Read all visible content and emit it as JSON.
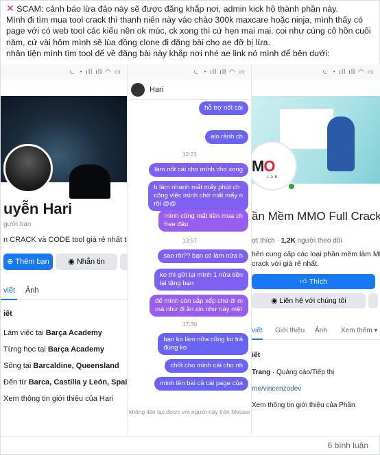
{
  "post": {
    "lines": [
      "SCAM: cảnh báo lừa đảo này sẽ được đăng khắp nơi, admin kick hộ thành phần này.",
      "Mình đi tìm mua tool crack thì thanh niên này vào chào 300k maxcare hoặc ninja, mình thấy có",
      "page với có web tool các kiểu nên ok múc, ck xong thì cứ hẹn mai mai. coi như cúng cô hồn cuối",
      "năm, cứ vài hôm mình sẽ lùa đồng clone đi đăng bài cho ae đỡ bị lừa.",
      "nhân tiện mình tìm tool để về đăng bài này khắp nơi nhé ae link nó mình để bên dưới:"
    ],
    "scam_icon": "red-x-icon",
    "comment_count": "6 bình luận"
  },
  "shot1": {
    "name": "uyễn Hari",
    "subtitle": "gười bạn",
    "bio": "n CRACK và CODE tool giá rẻ nhất thị trư",
    "add_friend": "Thêm bạn bè",
    "message": "Nhắn tin",
    "tab_posts": "viết",
    "tab_photos": "Ảnh",
    "section": "iết",
    "info": [
      {
        "prefix": "Làm việc tại ",
        "bold": "Barça Academy"
      },
      {
        "prefix": "Từng học tại ",
        "bold": "Barça Academy"
      },
      {
        "prefix": "Sống tại ",
        "bold": "Barcaldine, Queensland"
      },
      {
        "prefix": "Đến từ ",
        "bold": "Barca, Castilla y León, Spain"
      },
      {
        "prefix": "Xem thông tin giới thiệu của Hari",
        "bold": ""
      }
    ]
  },
  "shot2": {
    "contact": "Hari",
    "messages": [
      {
        "kind": "bubble",
        "text": "hỗ trợ nốt cài",
        "color": "b-blue"
      },
      {
        "kind": "bubble",
        "text": "alo rảnh ch",
        "color": "b-blue"
      },
      {
        "kind": "time",
        "text": "12:21"
      },
      {
        "kind": "bubble",
        "text": "làm nốt cài cho mình cho xong",
        "color": "b-violet"
      },
      {
        "kind": "bubble",
        "text": "b làm nhanh mất mấy phút ch\ncông việc mình chờ mất mấy n\nrồi @@",
        "color": "b-violet"
      },
      {
        "kind": "bubble",
        "text": "mình cũng mất tiền mua ch\nfree đâu",
        "color": "b-purple"
      },
      {
        "kind": "time",
        "text": "13:57"
      },
      {
        "kind": "bubble",
        "text": "sao rồi?? bạn có làm nữa h",
        "color": "b-violet"
      },
      {
        "kind": "bubble",
        "text": "ko thì gửi lại mình 1 nửa tiền\nlại tặng bạn",
        "color": "b-violet"
      },
      {
        "kind": "bubble",
        "text": "để mình còn sắp xếp chứ đi m\nmà như đi ăn xin như này mệt",
        "color": "b-purple"
      },
      {
        "kind": "time",
        "text": "17:30"
      },
      {
        "kind": "bubble",
        "text": "bạn ko làm nữa cũng ko trả\nđúng ko",
        "color": "b-blue"
      },
      {
        "kind": "bubble",
        "text": "chốt cho mình cái cho nh",
        "color": "b-blue"
      },
      {
        "kind": "bubble",
        "text": "mình lên bài cả cái page của",
        "color": "b-blue"
      }
    ],
    "footer": "không liên lạc được với người này trên Messer"
  },
  "shot3": {
    "name": "ần Mềm MMO Full Crack Giá",
    "likes_prefix": "ợt thích · ",
    "likes_bold": "1,2K",
    "likes_suffix": " người theo dõi",
    "desc": [
      "hên cung cấp các loại phần mềm làm MMO",
      "crack với giá rẻ nhất."
    ],
    "like_btn": "Thích",
    "contact_btn": "Liên hệ với chúng tôi",
    "tabs": [
      "viết",
      "Giới thiệu",
      "Ảnh",
      "Xem thêm"
    ],
    "section": "iết",
    "cat_bold": "Trang",
    "cat_text": " · Quảng cáo/Tiếp thị",
    "link": "me/vincenzodev",
    "more": "Xem thông tin giới thiệu của Phần",
    "logo_m": "M",
    "logo_o": "O",
    "logo_lab": "LAB"
  }
}
